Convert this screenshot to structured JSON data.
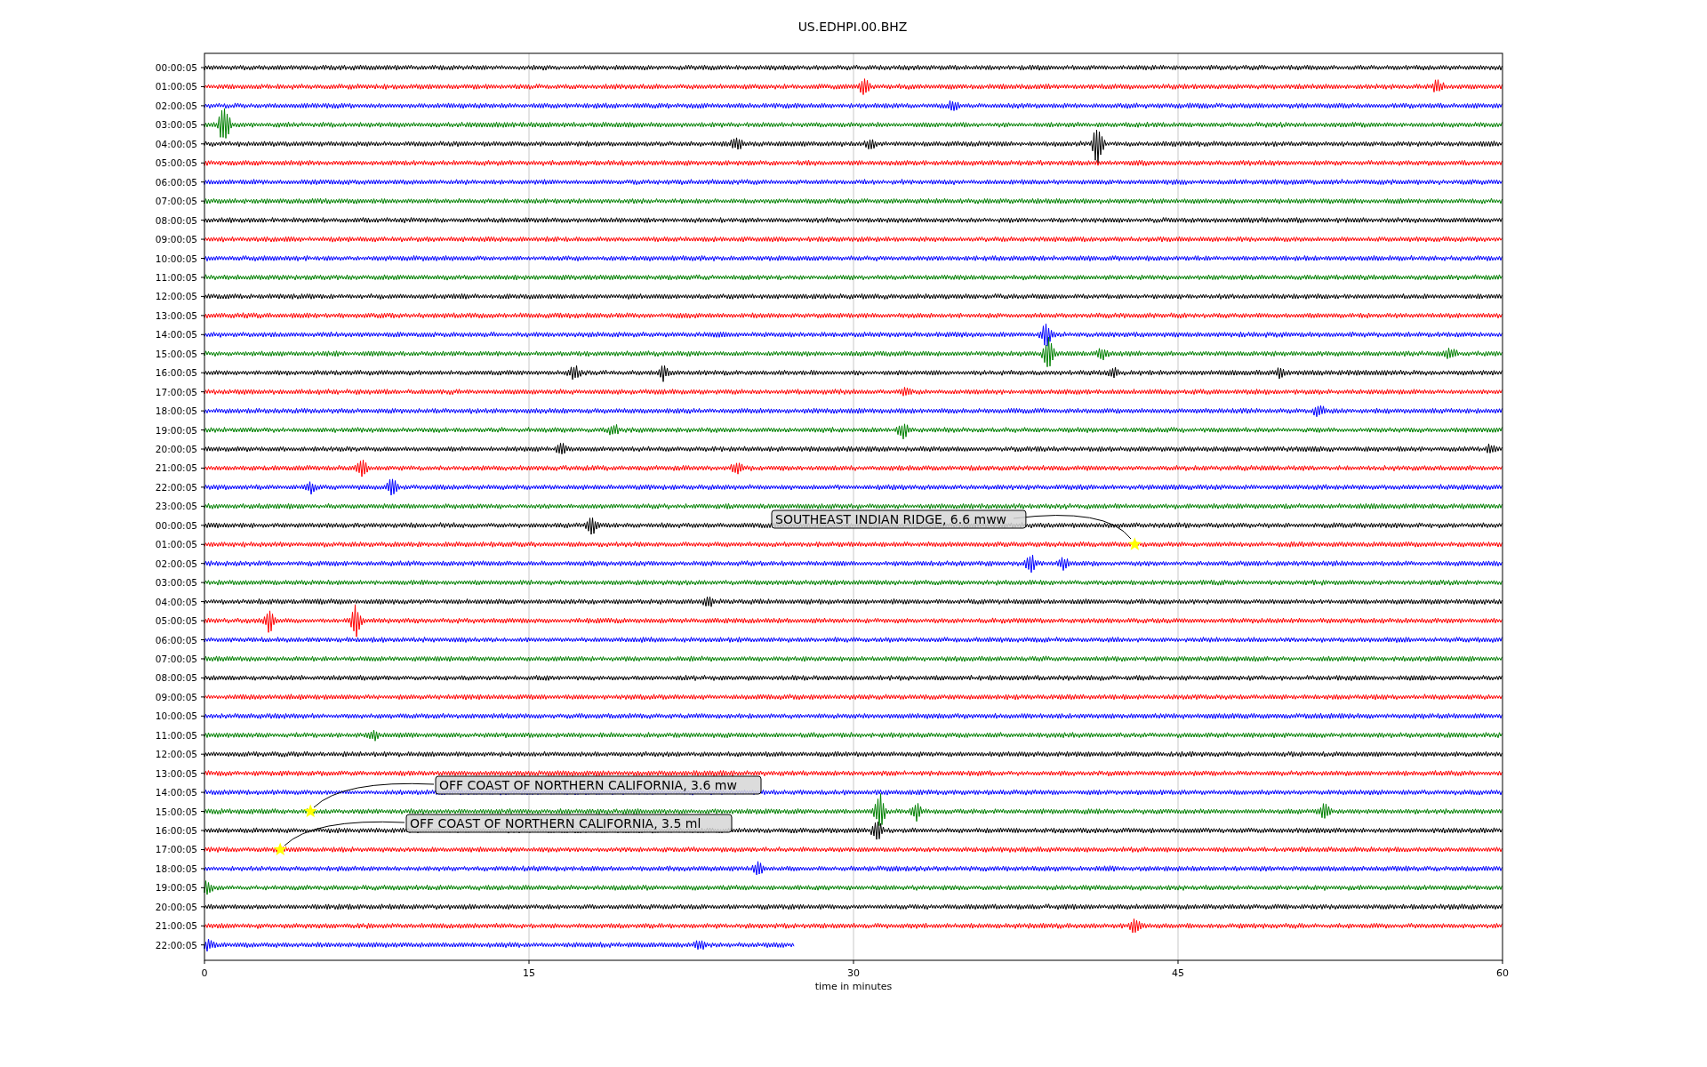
{
  "title": "US.EDHPI.00.BHZ",
  "rows": [
    {
      "label": "00:00:05",
      "color": "#000000"
    },
    {
      "label": "01:00:05",
      "color": "#ff0000"
    },
    {
      "label": "02:00:05",
      "color": "#0000ff"
    },
    {
      "label": "03:00:05",
      "color": "#008000"
    },
    {
      "label": "04:00:05",
      "color": "#000000"
    },
    {
      "label": "05:00:05",
      "color": "#ff0000"
    },
    {
      "label": "06:00:05",
      "color": "#0000ff"
    },
    {
      "label": "07:00:05",
      "color": "#008000"
    },
    {
      "label": "08:00:05",
      "color": "#000000"
    },
    {
      "label": "09:00:05",
      "color": "#ff0000"
    },
    {
      "label": "10:00:05",
      "color": "#0000ff"
    },
    {
      "label": "11:00:05",
      "color": "#008000"
    },
    {
      "label": "12:00:05",
      "color": "#000000"
    },
    {
      "label": "13:00:05",
      "color": "#ff0000"
    },
    {
      "label": "14:00:05",
      "color": "#0000ff"
    },
    {
      "label": "15:00:05",
      "color": "#008000"
    },
    {
      "label": "16:00:05",
      "color": "#000000"
    },
    {
      "label": "17:00:05",
      "color": "#ff0000"
    },
    {
      "label": "18:00:05",
      "color": "#0000ff"
    },
    {
      "label": "19:00:05",
      "color": "#008000"
    },
    {
      "label": "20:00:05",
      "color": "#000000"
    },
    {
      "label": "21:00:05",
      "color": "#ff0000"
    },
    {
      "label": "22:00:05",
      "color": "#0000ff"
    },
    {
      "label": "23:00:05",
      "color": "#008000"
    },
    {
      "label": "00:00:05",
      "color": "#000000"
    },
    {
      "label": "01:00:05",
      "color": "#ff0000"
    },
    {
      "label": "02:00:05",
      "color": "#0000ff"
    },
    {
      "label": "03:00:05",
      "color": "#008000"
    },
    {
      "label": "04:00:05",
      "color": "#000000"
    },
    {
      "label": "05:00:05",
      "color": "#ff0000"
    },
    {
      "label": "06:00:05",
      "color": "#0000ff"
    },
    {
      "label": "07:00:05",
      "color": "#008000"
    },
    {
      "label": "08:00:05",
      "color": "#000000"
    },
    {
      "label": "09:00:05",
      "color": "#ff0000"
    },
    {
      "label": "10:00:05",
      "color": "#0000ff"
    },
    {
      "label": "11:00:05",
      "color": "#008000"
    },
    {
      "label": "12:00:05",
      "color": "#000000"
    },
    {
      "label": "13:00:05",
      "color": "#ff0000"
    },
    {
      "label": "14:00:05",
      "color": "#0000ff"
    },
    {
      "label": "15:00:05",
      "color": "#008000"
    },
    {
      "label": "16:00:05",
      "color": "#000000"
    },
    {
      "label": "17:00:05",
      "color": "#ff0000"
    },
    {
      "label": "18:00:05",
      "color": "#0000ff"
    },
    {
      "label": "19:00:05",
      "color": "#008000"
    },
    {
      "label": "20:00:05",
      "color": "#000000"
    },
    {
      "label": "21:00:05",
      "color": "#ff0000"
    },
    {
      "label": "22:00:05",
      "color": "#0000ff"
    }
  ],
  "x_axis": {
    "ticks": [
      "0",
      "15",
      "30",
      "45",
      "60"
    ],
    "label": "time in minutes"
  },
  "annotations": [
    {
      "text": "SOUTHEAST INDIAN RIDGE, 6.6 mww"
    },
    {
      "text": "OFF COAST OF NORTHERN CALIFORNIA, 3.6 mw"
    },
    {
      "text": "OFF COAST OF NORTHERN CALIFORNIA, 3.5 ml"
    }
  ]
}
